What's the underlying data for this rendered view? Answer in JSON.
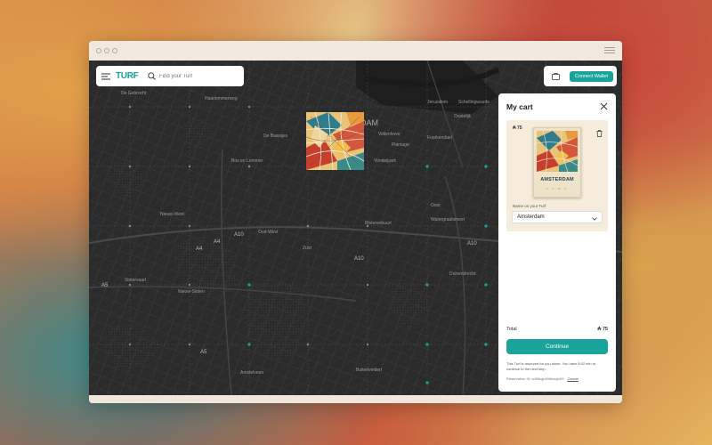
{
  "app": {
    "logo": "TURF"
  },
  "search": {
    "placeholder": "Find your Turf"
  },
  "header": {
    "connect_wallet": "Connect Wallet"
  },
  "map": {
    "labels": [
      {
        "text": "De Gebrocht",
        "big": false
      },
      {
        "text": "Haarlemmerweg",
        "big": false
      },
      {
        "text": "De Baarsjes",
        "big": false
      },
      {
        "text": "Bos en Lommer",
        "big": false
      },
      {
        "text": "Nieuw-West",
        "big": false
      },
      {
        "text": "Slotervaart",
        "big": false
      },
      {
        "text": "Oud-West",
        "big": false
      },
      {
        "text": "Zuid",
        "big": false
      },
      {
        "text": "Nieuw-Sloten",
        "big": false
      },
      {
        "text": "Amstelveen",
        "big": false
      },
      {
        "text": "A10",
        "big": true
      },
      {
        "text": "A10",
        "big": true
      },
      {
        "text": "A10",
        "big": true
      },
      {
        "text": "A4",
        "big": true
      },
      {
        "text": "A4",
        "big": true
      },
      {
        "text": "A5",
        "big": true
      },
      {
        "text": "A5",
        "big": true
      },
      {
        "text": "DAM",
        "big": true
      },
      {
        "text": "Plantage",
        "big": false
      },
      {
        "text": "Vondelpark",
        "big": false
      },
      {
        "text": "Rivierenbuurt",
        "big": false
      },
      {
        "text": "Oost",
        "big": false
      },
      {
        "text": "Duivendrecht",
        "big": false
      },
      {
        "text": "Watergraafsmeer",
        "big": false
      },
      {
        "text": "Schellingwoude",
        "big": false
      },
      {
        "text": "Jeruzalem",
        "big": false
      },
      {
        "text": "Oostelijk",
        "big": false
      },
      {
        "text": "Vollenhove",
        "big": false
      },
      {
        "text": "Frankendael",
        "big": false
      },
      {
        "text": "Buitenveldert",
        "big": false
      }
    ]
  },
  "cart": {
    "title": "My cart",
    "item": {
      "price": "₳ 75",
      "city": "AMSTERDAM",
      "poster_sub": "T U R F",
      "name_label": "Name on your Turf",
      "name_value": "Amsterdam"
    },
    "total_label": "Total",
    "total_value": "₳ 75",
    "continue_label": "Continue",
    "note": "This Turf is reserved for you alone. You have 8:02 min to continue to the next step.",
    "reservation_label": "Reservation ID: ic83bqjm0l9bdqkr09",
    "cancel_label": "Cancel"
  },
  "colors": {
    "accent": "#1aa39a",
    "map_bg": "#2b2b2b",
    "cart_item_bg": "#f6ecdc"
  }
}
